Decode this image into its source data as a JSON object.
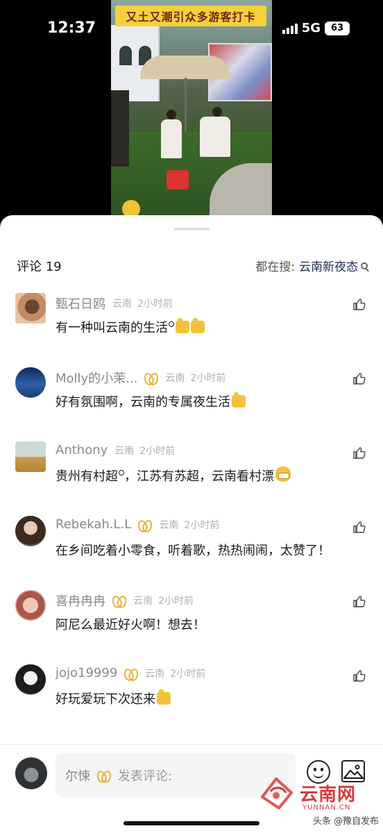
{
  "status_bar": {
    "time": "12:37",
    "network": "5G",
    "battery": "63"
  },
  "video": {
    "banner_text": "又土又潮引众多游客打卡"
  },
  "comments_panel": {
    "count_label": "评论 19",
    "hot_search_label": "都在搜:",
    "hot_search_keyword": "云南新夜态"
  },
  "comments": [
    {
      "name": "甄石日鸥",
      "location": "云南",
      "time": "2小时前",
      "text": "有一种叫云南的生活"
    },
    {
      "name": "Molly的小茉...",
      "location": "云南",
      "time": "2小时前",
      "text": "好有氛围啊，云南的专属夜生活"
    },
    {
      "name": "Anthony",
      "location": "云南",
      "time": "2小时前",
      "text_a": "贵州有村超",
      "text_b": "，江苏有苏超，云南看村漂"
    },
    {
      "name": "Rebekah.L.L",
      "location": "云南",
      "time": "2小时前",
      "text": "在乡间吃着小零食，听着歌，热热闹闹，太赞了！"
    },
    {
      "name": "喜冉冉冉",
      "location": "云南",
      "time": "2小时前",
      "text": "阿尼么最近好火啊！想去！"
    },
    {
      "name": "jojo19999",
      "location": "云南",
      "time": "2小时前",
      "text": "好玩爱玩下次还来"
    }
  ],
  "input_bar": {
    "user_name": "尔悚",
    "placeholder": "发表评论:"
  },
  "watermark": {
    "name": "云南网",
    "domain": "YUNNAN.CN",
    "credit": "头条 @豫自发布"
  },
  "icons": [
    "like-icon",
    "emoji-icon",
    "image-icon",
    "search-icon",
    "badge-icon"
  ]
}
